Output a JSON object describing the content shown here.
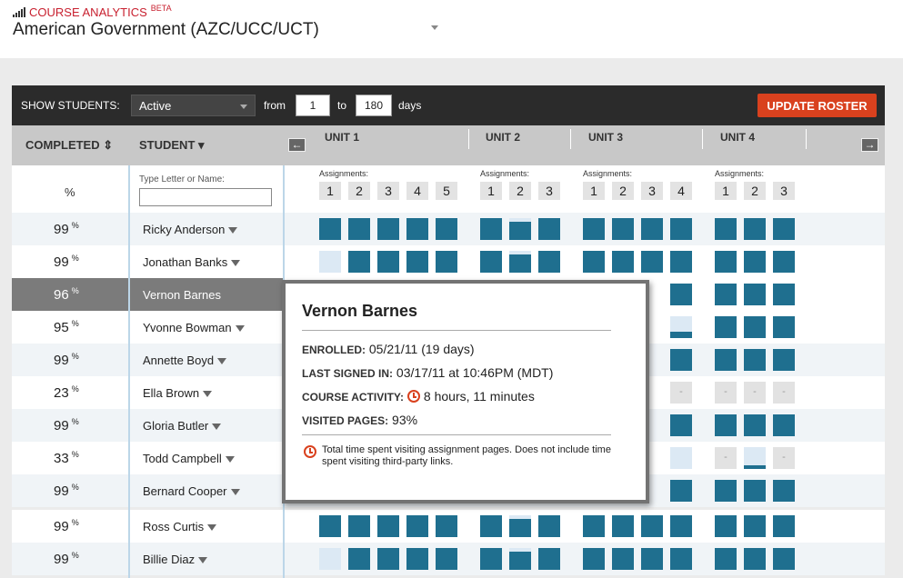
{
  "header": {
    "brand": "COURSE ANALYTICS",
    "beta": "BETA",
    "course_title": "American Government (AZC/UCC/UCT)"
  },
  "toolbar": {
    "show_students_label": "SHOW STUDENTS:",
    "filter_value": "Active",
    "from_label": "from",
    "from_value": "1",
    "to_label": "to",
    "to_value": "180",
    "days_label": "days",
    "update_button": "UPDATE ROSTER"
  },
  "columns": {
    "completed": "COMPLETED",
    "student": "STUDENT",
    "percent_label": "%",
    "name_filter_label": "Type Letter or Name:",
    "assignments_label": "Assignments:",
    "units": [
      {
        "label": "UNIT 1",
        "assignments": [
          "1",
          "2",
          "3",
          "4",
          "5"
        ]
      },
      {
        "label": "UNIT 2",
        "assignments": [
          "1",
          "2",
          "3"
        ]
      },
      {
        "label": "UNIT 3",
        "assignments": [
          "1",
          "2",
          "3",
          "4"
        ]
      },
      {
        "label": "UNIT 4",
        "assignments": [
          "1",
          "2",
          "3"
        ]
      }
    ]
  },
  "students": [
    {
      "percent": "99",
      "name": "Ricky Anderson"
    },
    {
      "percent": "99",
      "name": "Jonathan Banks"
    },
    {
      "percent": "96",
      "name": "Vernon Barnes"
    },
    {
      "percent": "95",
      "name": "Yvonne Bowman"
    },
    {
      "percent": "99",
      "name": "Annette Boyd"
    },
    {
      "percent": "23",
      "name": "Ella Brown"
    },
    {
      "percent": "99",
      "name": "Gloria Butler"
    },
    {
      "percent": "33",
      "name": "Todd Campbell"
    },
    {
      "percent": "99",
      "name": "Bernard Cooper"
    },
    {
      "percent": "99",
      "name": "Ross Curtis"
    },
    {
      "percent": "99",
      "name": "Billie Diaz"
    }
  ],
  "percent_sign": "%",
  "dash": "-",
  "popup": {
    "name": "Vernon Barnes",
    "enrolled_label": "ENROLLED:",
    "enrolled_value": "05/21/11 (19 days)",
    "last_signed_label": "LAST SIGNED IN:",
    "last_signed_value": "03/17/11 at 10:46PM (MDT)",
    "activity_label": "COURSE ACTIVITY:",
    "activity_value": "8 hours, 11 minutes",
    "visited_label": "VISITED PAGES:",
    "visited_value": "93%",
    "note": "Total time spent visiting assignment pages. Does not include time spent visiting third-party links."
  },
  "colors": {
    "accent": "#d9411e",
    "complete": "#1f6f8f",
    "incomplete": "#dce9f4",
    "brand": "#c8202f"
  }
}
